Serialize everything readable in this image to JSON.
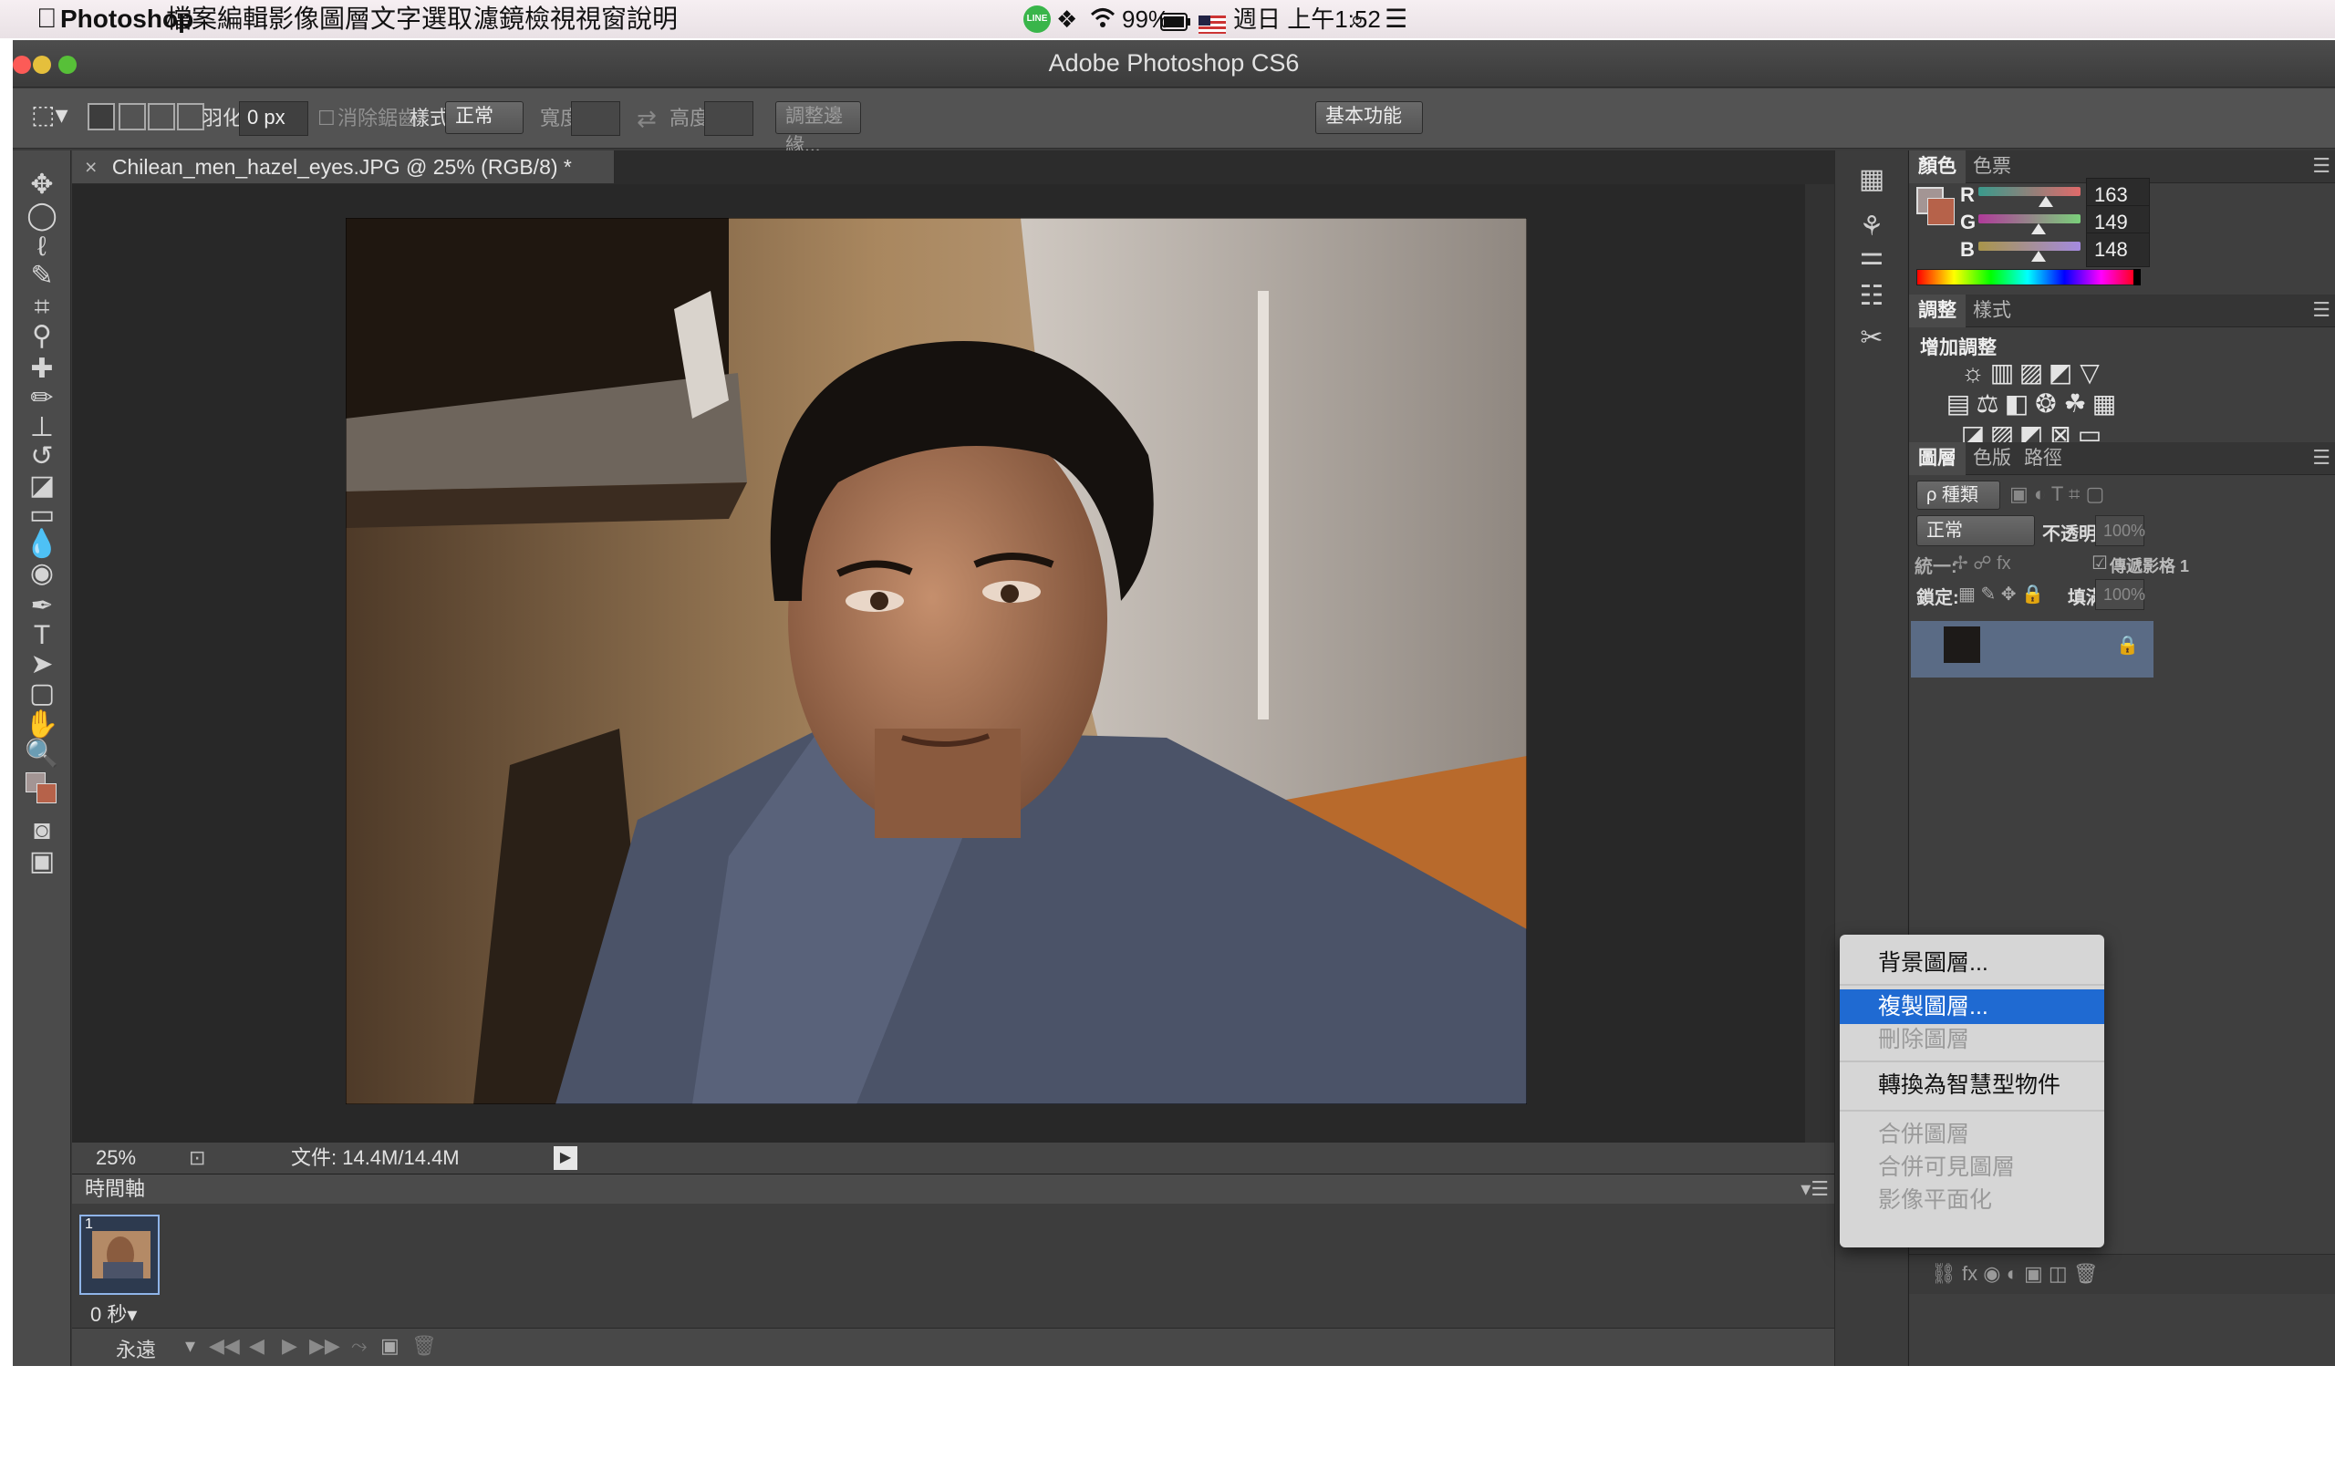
{
  "menubar": {
    "app_name": "Photoshop",
    "menus": [
      "檔案",
      "編輯",
      "影像",
      "圖層",
      "文字",
      "選取",
      "濾鏡",
      "檢視",
      "視窗",
      "說明"
    ],
    "line_badge": "LINE",
    "battery": "99%",
    "clock": "週日 上午1:52"
  },
  "window": {
    "title": "Adobe Photoshop CS6"
  },
  "options_bar": {
    "feather_label": "羽化:",
    "feather_value": "0 px",
    "antialias_label": "消除鋸齒",
    "style_label": "樣式:",
    "style_value": "正常",
    "width_label": "寬度:",
    "height_label": "高度:",
    "refine_edge_button": "調整邊緣...",
    "workspace_value": "基本功能"
  },
  "document": {
    "tab_title": "Chilean_men_hazel_eyes.JPG @ 25% (RGB/8) *",
    "zoom": "25%",
    "doc_size": "文件: 14.4M/14.4M"
  },
  "timeline": {
    "title": "時間軸",
    "frame_number": "1",
    "frame_delay": "0 秒▾",
    "loop_value": "永遠"
  },
  "color_panel": {
    "tabs": [
      "顏色",
      "色票"
    ],
    "r_label": "R",
    "g_label": "G",
    "b_label": "B",
    "r": "163",
    "g": "149",
    "b": "148",
    "foreground_color": "#a39594",
    "background_color": "#b6624a"
  },
  "adjustments_panel": {
    "tabs": [
      "調整",
      "樣式"
    ],
    "heading": "增加調整"
  },
  "layers_panel": {
    "tabs": [
      "圖層",
      "色版",
      "路徑"
    ],
    "filter_kind": "ρ 種類",
    "blend_mode": "正常",
    "opacity_label": "不透明度:",
    "opacity_value": "100%",
    "unify_label": "統一:",
    "propagate_label": "傳遞影格 1",
    "lock_label": "鎖定:",
    "fill_label": "填滿:",
    "fill_value": "100%"
  },
  "context_menu": {
    "items": [
      {
        "label": "背景圖層...",
        "state": "normal"
      },
      {
        "label": "複製圖層...",
        "state": "highlighted"
      },
      {
        "label": "刪除圖層",
        "state": "disabled"
      },
      {
        "label": "轉換為智慧型物件",
        "state": "normal"
      },
      {
        "label": "合併圖層",
        "state": "disabled"
      },
      {
        "label": "合併可見圖層",
        "state": "disabled"
      },
      {
        "label": "影像平面化",
        "state": "disabled"
      }
    ]
  },
  "colors": {
    "highlight": "#1f6ad2",
    "panel_bg": "#3f3f3f",
    "line_green": "#39b54a"
  }
}
